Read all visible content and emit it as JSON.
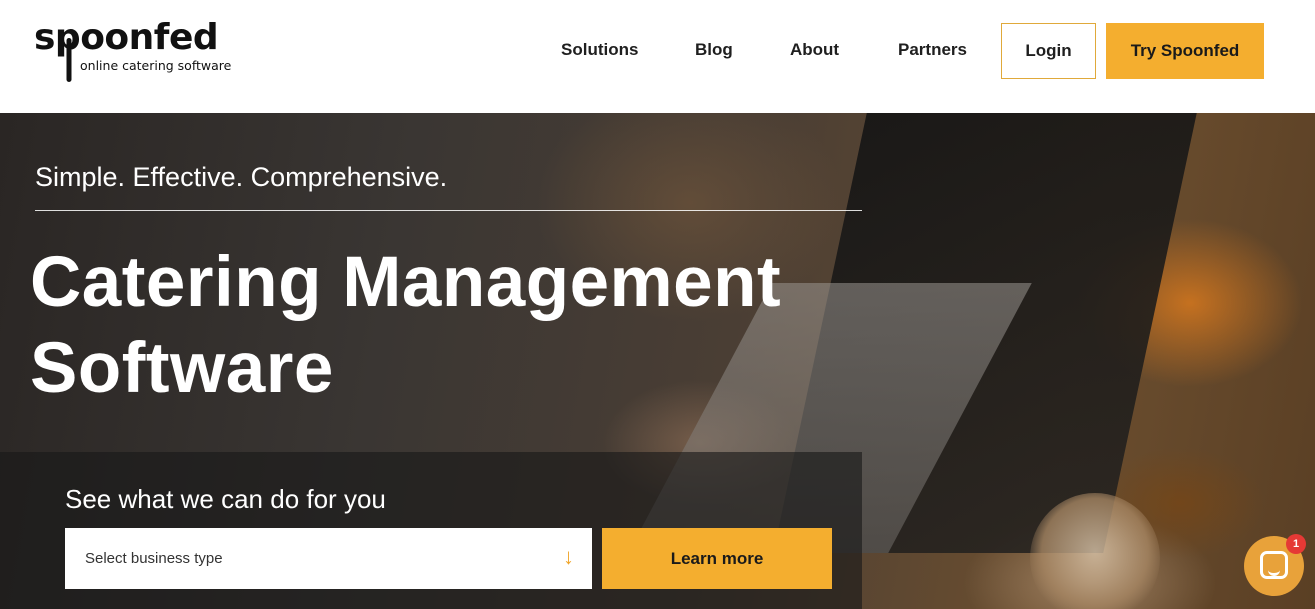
{
  "brand": {
    "name": "spoonfed",
    "tagline": "online catering software",
    "accent_color": "#f4ae2f"
  },
  "nav": {
    "items": [
      {
        "label": "Solutions"
      },
      {
        "label": "Blog"
      },
      {
        "label": "About"
      },
      {
        "label": "Partners"
      }
    ],
    "login_label": "Login",
    "try_label": "Try Spoonfed"
  },
  "hero": {
    "tagline": "Simple. Effective. Comprehensive.",
    "headline_line1": "Catering Management",
    "headline_line2": "Software",
    "cta_title": "See what we can do for you",
    "select_placeholder": "Select business type",
    "select_arrow_icon": "arrow-down-icon",
    "learn_more_label": "Learn more"
  },
  "chat": {
    "icon": "chat-icon",
    "badge_count": "1"
  }
}
